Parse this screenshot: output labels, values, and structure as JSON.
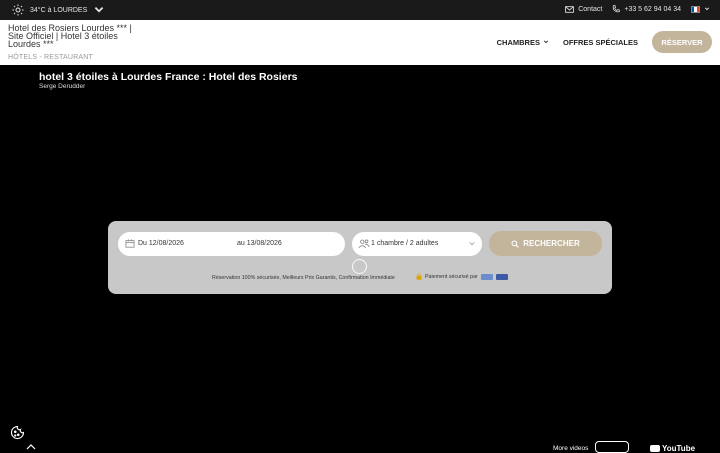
{
  "topbar": {
    "weather": "34°C à LOURDES",
    "contact": "Contact",
    "phone": "+33 5 62 94 04 34"
  },
  "header": {
    "brand": "Hotel des Rosiers Lourdes *** | Site Officiel | Hotel 3 étoiles Lourdes ***",
    "breadcrumb": "HÔTELS - RESTAURANT",
    "nav": {
      "rooms": "CHAMBRES",
      "offers": "OFFRES SPÉCIALES",
      "reserve": "RÉSERVER"
    }
  },
  "video": {
    "title": "hotel 3 étoiles à Lourdes France : Hotel des Rosiers",
    "author": "Serge Derudder",
    "more_videos": "More videos",
    "youtube": "YouTube"
  },
  "booking": {
    "date_from": "Du 12/08/2026",
    "date_to": "au 13/08/2026",
    "guests": "1 chambre / 2 adultes",
    "search": "RECHERCHER",
    "reassurance": "Réservation 100% sécurisée, Meilleurs Prix Garantis, Confirmation Immédiate",
    "secure_payment": "Paiement sécurisé par"
  },
  "colors": {
    "accent": "#c3b49c",
    "topbar": "#1a1a1a",
    "booking_bg": "#c8c8c8"
  }
}
